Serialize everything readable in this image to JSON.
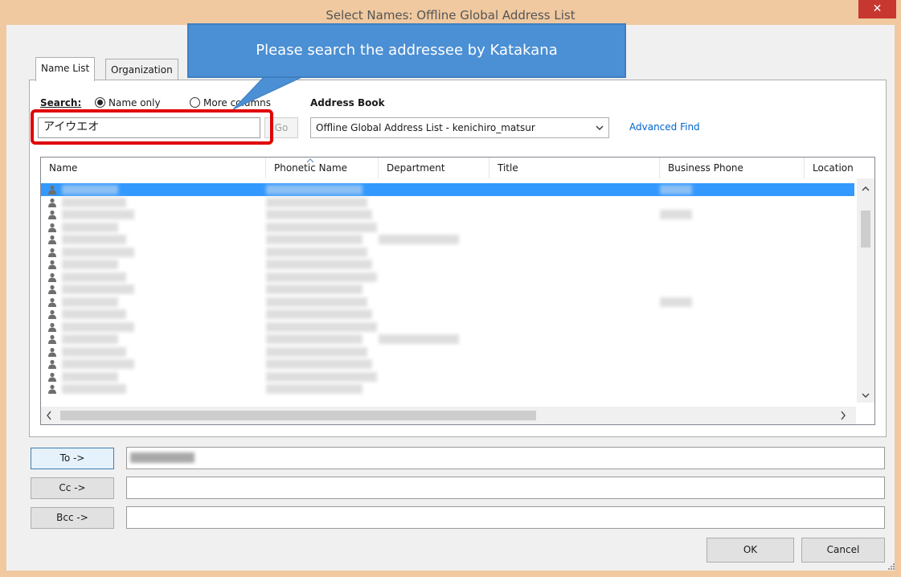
{
  "window": {
    "title": "Select Names: Offline Global Address List",
    "close_glyph": "✕"
  },
  "tabs": [
    {
      "label": "Name List",
      "active": true
    },
    {
      "label": "Organization",
      "active": false
    }
  ],
  "search": {
    "label": "Search:",
    "option_name_only": "Name only",
    "option_more_columns": "More columns",
    "selected": "Name only",
    "value": "アイウエオ",
    "go_label": "Go"
  },
  "address_book": {
    "label": "Address Book",
    "selected": "Offline Global Address List - kenichiro_matsur",
    "advanced_find": "Advanced Find"
  },
  "columns": [
    "Name",
    "Phonetic Name",
    "Department",
    "Title",
    "Business Phone",
    "Location"
  ],
  "rows_visible": 17,
  "selected_row": 0,
  "recipients": {
    "to_label": "To ->",
    "cc_label": "Cc ->",
    "bcc_label": "Bcc ->"
  },
  "buttons": {
    "ok": "OK",
    "cancel": "Cancel"
  },
  "annotation": {
    "callout_text": "Please search the addressee by Katakana"
  },
  "colors": {
    "selection": "#3399ff",
    "link": "#0066cc",
    "callout": "#4b8fd4",
    "highlight_box": "#e00000"
  }
}
